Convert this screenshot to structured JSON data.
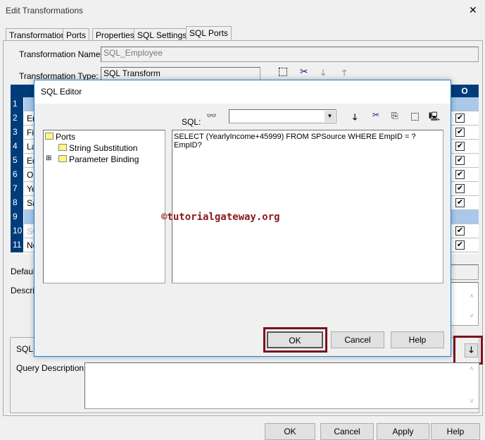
{
  "window": {
    "title": "Edit Transformations",
    "close": "✕"
  },
  "tabs": [
    "Transformation",
    "Ports",
    "Properties",
    "SQL Settings",
    "SQL Ports"
  ],
  "form": {
    "name_label": "Transformation Name:",
    "name_value": "SQL_Employee",
    "type_label": "Transformation Type:",
    "type_value": "SQL Transform"
  },
  "grid": {
    "header_last": "O",
    "rows": [
      {
        "n": "1",
        "text": "",
        "group": true,
        "check": false
      },
      {
        "n": "2",
        "text": "En",
        "check": true
      },
      {
        "n": "3",
        "text": "Fi",
        "check": true
      },
      {
        "n": "4",
        "text": "La",
        "check": true
      },
      {
        "n": "5",
        "text": "Ed",
        "check": true
      },
      {
        "n": "6",
        "text": "O",
        "check": true
      },
      {
        "n": "7",
        "text": "Ye",
        "check": true
      },
      {
        "n": "8",
        "text": "Sa",
        "check": true
      },
      {
        "n": "9",
        "text": "",
        "group": true,
        "check": false
      },
      {
        "n": "10",
        "text": "SQ",
        "check": true,
        "dim": true
      },
      {
        "n": "11",
        "text": "Ne",
        "check": true
      }
    ]
  },
  "lower": {
    "default_label": "Default",
    "descrip_label": "Descrip",
    "sql_label": "SQL",
    "query_desc_label": "Query Description:"
  },
  "footer": {
    "ok": "OK",
    "cancel": "Cancel",
    "apply": "Apply",
    "help": "Help"
  },
  "editor": {
    "title": "SQL Editor",
    "sql_label": "SQL:",
    "combo_value": "",
    "tree": {
      "root": "Ports",
      "children": [
        "String Substitution",
        "Parameter Binding"
      ]
    },
    "query": "SELECT (YearlyIncome+45999) FROM SPSource WHERE EmpID = ?EmpID?",
    "ok": "OK",
    "cancel": "Cancel",
    "help": "Help"
  },
  "watermark": "©tutorialgateway.org",
  "colors": {
    "accent": "#003c7a",
    "highlight": "#7b1020",
    "dialog_border": "#1883d7"
  }
}
